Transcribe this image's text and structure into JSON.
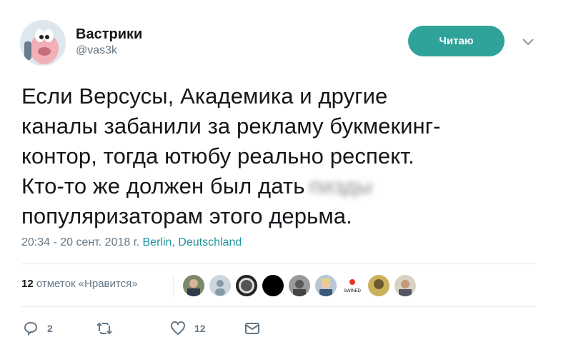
{
  "tweet": {
    "display_name": "Вастрики",
    "handle": "@vas3k",
    "follow_button": "Читаю",
    "text_lines": [
      "Если Версусы, Академика и другие",
      "каналы забанили за рекламу букмекинг-",
      "контор, тогда ютюбу реально респект.",
      "Кто-то же должен был дать",
      "популяризаторам этого дерьма."
    ],
    "censored_word": "пизды",
    "time_date": "20:34 - 20 сент. 2018 г.",
    "location": "Berlin, Deutschland",
    "likes_count": "12",
    "likes_label": "отметок «Нравится»",
    "liker_avatars": [
      "face-1",
      "face-2-default",
      "face-3-portrait",
      "face-4-black",
      "face-5-gray",
      "face-6-blond",
      "face-7-swine-logo",
      "face-8",
      "face-9"
    ],
    "swine_logo_text": "SWINED",
    "actions": {
      "reply_count": "2",
      "retweet_count": "",
      "like_count": "12"
    },
    "colors": {
      "accent": "#2fa29a",
      "link": "#1b95a0",
      "muted": "#657786"
    }
  }
}
